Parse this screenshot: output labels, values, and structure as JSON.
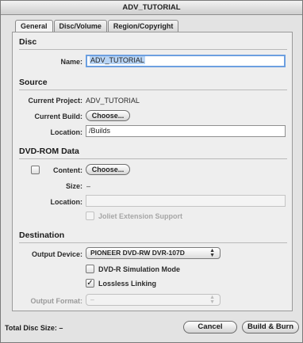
{
  "window": {
    "title": "ADV_TUTORIAL"
  },
  "tabs": [
    {
      "label": "General",
      "active": true
    },
    {
      "label": "Disc/Volume",
      "active": false
    },
    {
      "label": "Region/Copyright",
      "active": false
    }
  ],
  "disc": {
    "heading": "Disc",
    "name_label": "Name:",
    "name_value": "ADV_TUTORIAL"
  },
  "source": {
    "heading": "Source",
    "current_project_label": "Current Project:",
    "current_project_value": "ADV_TUTORIAL",
    "current_build_label": "Current Build:",
    "choose_label": "Choose...",
    "location_label": "Location:",
    "location_value": "/Builds"
  },
  "dvd_rom": {
    "heading": "DVD-ROM Data",
    "content_label": "Content:",
    "content_checked": false,
    "choose_label": "Choose...",
    "size_label": "Size:",
    "size_value": "–",
    "location_label": "Location:",
    "location_value": "",
    "joliet_label": "Joliet Extension Support",
    "joliet_checked": false
  },
  "destination": {
    "heading": "Destination",
    "output_device_label": "Output Device:",
    "output_device_value": "PIONEER DVD-RW  DVR-107D",
    "simulation_label": "DVD-R Simulation Mode",
    "simulation_checked": false,
    "lossless_label": "Lossless Linking",
    "lossless_checked": true,
    "output_format_label": "Output Format:",
    "output_format_value": "–"
  },
  "footer": {
    "total_size_label": "Total Disc Size:",
    "total_size_value": "–",
    "cancel_label": "Cancel",
    "build_burn_label": "Build & Burn"
  },
  "icons": {
    "check": "checkmark-icon",
    "popup_arrows": "updown-arrows-icon"
  },
  "colors": {
    "focus_ring": "#6c9fe0",
    "selection": "#b8d4f4"
  }
}
